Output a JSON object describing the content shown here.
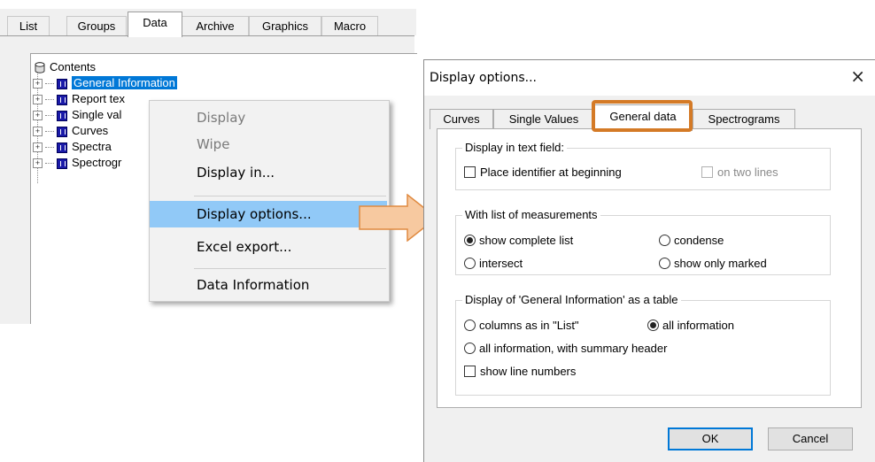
{
  "main_tabs": [
    {
      "label": "List"
    },
    {
      "label": "Groups"
    },
    {
      "label": "Data"
    },
    {
      "label": "Archive"
    },
    {
      "label": "Graphics"
    },
    {
      "label": "Macro"
    }
  ],
  "tree": {
    "root": "Contents",
    "items": [
      {
        "label": "General Information"
      },
      {
        "label": "Report tex"
      },
      {
        "label": "Single val"
      },
      {
        "label": "Curves"
      },
      {
        "label": "Spectra"
      },
      {
        "label": "Spectrogr"
      }
    ]
  },
  "context_menu": {
    "items": [
      {
        "label": "Display",
        "enabled": false
      },
      {
        "label": "Wipe",
        "enabled": false
      },
      {
        "label": "Display in...",
        "enabled": true
      },
      {
        "label": "Display options...",
        "enabled": true,
        "highlighted": true
      },
      {
        "label": "Excel export...",
        "enabled": true
      },
      {
        "label": "Data Information",
        "enabled": true
      }
    ]
  },
  "dialog": {
    "title": "Display options...",
    "close_glyph": "×",
    "tabs": [
      {
        "label": "Curves"
      },
      {
        "label": "Single Values"
      },
      {
        "label": "General data"
      },
      {
        "label": "Spectrograms"
      }
    ],
    "active_tab": "General data",
    "groups": {
      "text_field": {
        "title": "Display in text field:",
        "place_identifier": "Place identifier at beginning",
        "two_lines": "on two lines"
      },
      "measurements": {
        "title": "With list of measurements",
        "show_complete": "show complete list",
        "condense": "condense",
        "intersect": "intersect",
        "show_marked": "show only marked",
        "selected": "show complete list"
      },
      "table": {
        "title": "Display of 'General Information' as a table",
        "columns_as_list": "columns as in \"List\"",
        "all_information": "all information",
        "all_with_header": "all information, with summary header",
        "show_line_numbers": "show line numbers",
        "selected": "all information"
      }
    },
    "ok_label": "OK",
    "cancel_label": "Cancel"
  },
  "colors": {
    "selection": "#0078d7",
    "menu_highlight": "#91c9f7",
    "tab_highlight_border": "#d47a26",
    "arrow_fill": "#f7c9a0",
    "arrow_stroke": "#e08a40"
  }
}
